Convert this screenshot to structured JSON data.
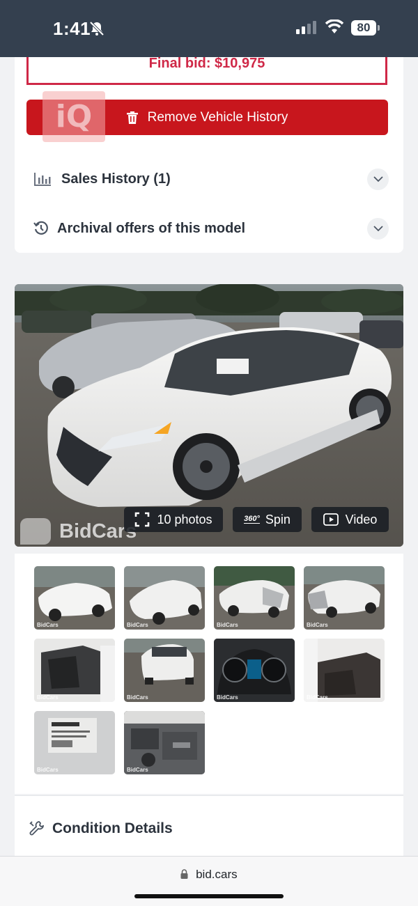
{
  "status_bar": {
    "time": "1:41",
    "battery": "80"
  },
  "top_card": {
    "final_bid": "Final bid: $10,975",
    "remove_button": "Remove Vehicle History",
    "iq_badge": "iQ",
    "sales_history": "Sales History (1)",
    "archival_offers": "Archival offers of this model"
  },
  "photo": {
    "photos_button": "10 photos",
    "spin_badge": "360°",
    "spin_button": "Spin",
    "video_button": "Video",
    "watermark": "BidCars"
  },
  "thumbnails": {
    "count": 10,
    "watermark": "BidCars"
  },
  "condition": {
    "title": "Condition Details"
  },
  "browser": {
    "url": "bid.cars"
  },
  "colors": {
    "status_bar": "#34404f",
    "accent_red": "#c8161d",
    "bid_red": "#cf2847",
    "background": "#f1f2f4"
  }
}
